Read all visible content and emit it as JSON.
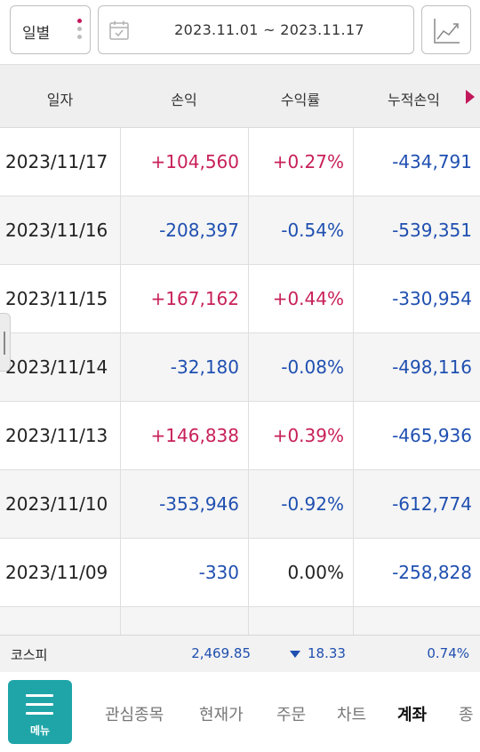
{
  "toolbar": {
    "period_label": "일별",
    "date_range": "2023.11.01 ~ 2023.11.17",
    "icons": {
      "period_menu": "kebab-dots-icon",
      "calendar": "calendar-icon",
      "chart": "line-chart-icon"
    },
    "dot_colors": [
      "#c2185b",
      "#bdbdbd",
      "#bdbdbd"
    ]
  },
  "table": {
    "headers": {
      "date": "일자",
      "pl": "손익",
      "rate": "수익률",
      "cum": "누적손익"
    },
    "rows": [
      {
        "date": "2023/11/17",
        "pl": "+104,560",
        "rate": "+0.27%",
        "cum": "-434,791",
        "pl_sign": "pos",
        "rate_sign": "pos",
        "cum_sign": "neg"
      },
      {
        "date": "2023/11/16",
        "pl": "-208,397",
        "rate": "-0.54%",
        "cum": "-539,351",
        "pl_sign": "neg",
        "rate_sign": "neg",
        "cum_sign": "neg"
      },
      {
        "date": "2023/11/15",
        "pl": "+167,162",
        "rate": "+0.44%",
        "cum": "-330,954",
        "pl_sign": "pos",
        "rate_sign": "pos",
        "cum_sign": "neg"
      },
      {
        "date": "2023/11/14",
        "pl": "-32,180",
        "rate": "-0.08%",
        "cum": "-498,116",
        "pl_sign": "neg",
        "rate_sign": "neg",
        "cum_sign": "neg"
      },
      {
        "date": "2023/11/13",
        "pl": "+146,838",
        "rate": "+0.39%",
        "cum": "-465,936",
        "pl_sign": "pos",
        "rate_sign": "pos",
        "cum_sign": "neg"
      },
      {
        "date": "2023/11/10",
        "pl": "-353,946",
        "rate": "-0.92%",
        "cum": "-612,774",
        "pl_sign": "neg",
        "rate_sign": "neg",
        "cum_sign": "neg"
      },
      {
        "date": "2023/11/09",
        "pl": "-330",
        "rate": "0.00%",
        "cum": "-258,828",
        "pl_sign": "neg",
        "rate_sign": "zero",
        "cum_sign": "neg"
      }
    ]
  },
  "ticker": {
    "name": "코스피",
    "index": "2,469.85",
    "change": "18.33",
    "change_pct": "0.74%",
    "direction_icon": "down-triangle-icon"
  },
  "bottom_nav": {
    "menu_label": "메뉴",
    "items": [
      "관심종목",
      "현재가",
      "주문",
      "차트",
      "계좌",
      "종"
    ],
    "active": "계좌"
  },
  "colors": {
    "positive": "#c8205a",
    "negative": "#1f4fb0",
    "menu_button": "#1fa5a8",
    "header_arrow": "#c2185b"
  }
}
